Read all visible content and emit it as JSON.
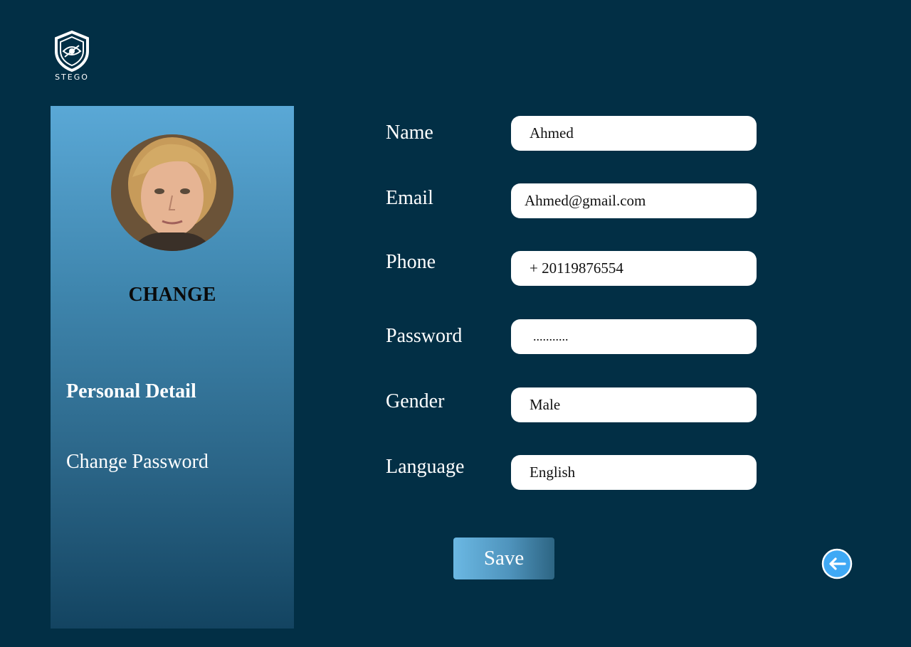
{
  "logo": {
    "text": "STEGO"
  },
  "sidebar": {
    "change_label": "CHANGE",
    "nav": [
      {
        "label": "Personal Detail",
        "active": true
      },
      {
        "label": "Change Password",
        "active": false
      }
    ]
  },
  "form": {
    "fields": [
      {
        "label": "Name",
        "value": "Ahmed"
      },
      {
        "label": "Email",
        "value": "Ahmed@gmail.com"
      },
      {
        "label": "Phone",
        "value": "+ 20119876554"
      },
      {
        "label": "Password",
        "value": "..........."
      },
      {
        "label": "Gender",
        "value": "Male"
      },
      {
        "label": "Language",
        "value": "English"
      }
    ],
    "save_label": "Save"
  },
  "icons": {
    "logo": "shield-eye-icon",
    "back": "arrow-left-icon"
  },
  "colors": {
    "background": "#022f45",
    "sidebar_top": "#5aa8d6",
    "sidebar_bottom": "#134461",
    "input_bg": "#ffffff",
    "accent": "#3fa9f5"
  }
}
